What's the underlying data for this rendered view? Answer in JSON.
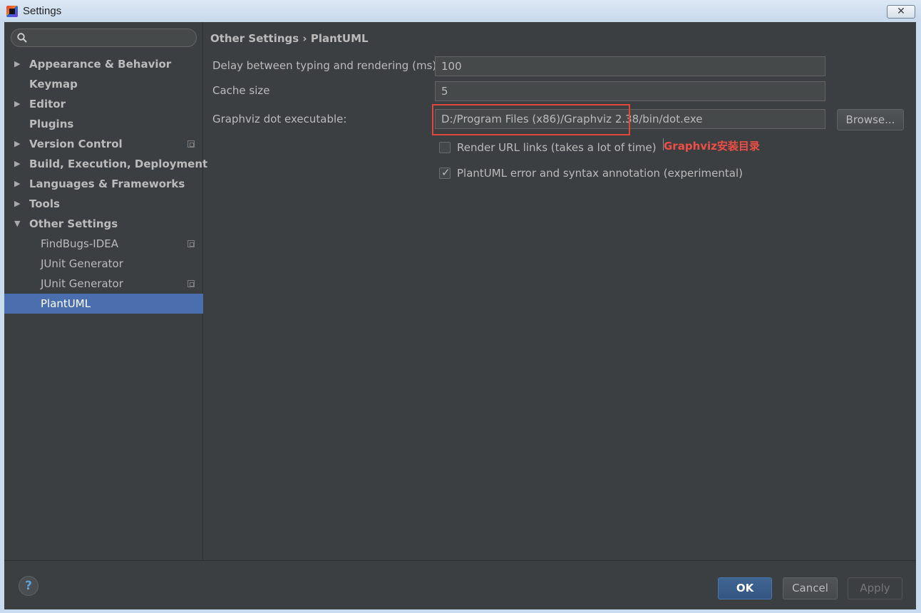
{
  "window": {
    "title": "Settings",
    "close_glyph": "✕"
  },
  "sidebar": {
    "search_placeholder": "",
    "items": [
      {
        "label": "Appearance & Behavior",
        "expandable": true,
        "expanded": false,
        "bold": true
      },
      {
        "label": "Keymap",
        "expandable": false,
        "bold": true
      },
      {
        "label": "Editor",
        "expandable": true,
        "expanded": false,
        "bold": true
      },
      {
        "label": "Plugins",
        "expandable": false,
        "bold": true
      },
      {
        "label": "Version Control",
        "expandable": true,
        "expanded": false,
        "bold": true,
        "project_icon": true
      },
      {
        "label": "Build, Execution, Deployment",
        "expandable": true,
        "expanded": false,
        "bold": true
      },
      {
        "label": "Languages & Frameworks",
        "expandable": true,
        "expanded": false,
        "bold": true
      },
      {
        "label": "Tools",
        "expandable": true,
        "expanded": false,
        "bold": true
      },
      {
        "label": "Other Settings",
        "expandable": true,
        "expanded": true,
        "bold": true
      },
      {
        "label": "FindBugs-IDEA",
        "child": true,
        "project_icon": true
      },
      {
        "label": "JUnit Generator",
        "child": true
      },
      {
        "label": "JUnit Generator",
        "child": true,
        "project_icon": true
      },
      {
        "label": "PlantUML",
        "child": true,
        "selected": true
      }
    ],
    "arrows": {
      "collapsed": "▶",
      "expanded": "▼"
    }
  },
  "content": {
    "breadcrumb": "Other Settings › PlantUML",
    "fields": {
      "delay_label": "Delay between typing and rendering (ms)",
      "delay_value": "100",
      "cache_label": "Cache size",
      "cache_value": "5",
      "graphviz_label": "Graphviz dot executable:",
      "graphviz_value": "D:/Program Files (x86)/Graphviz 2.38/bin/dot.exe",
      "browse_label": "Browse..."
    },
    "checkboxes": {
      "render_url": {
        "label": "Render URL links (takes a lot of time)",
        "checked": false
      },
      "error_annotation": {
        "label": "PlantUML error and syntax annotation (experimental)",
        "checked": true
      }
    },
    "annotation": "Graphviz安装目录",
    "check_glyph": "✓"
  },
  "footer": {
    "help": "?",
    "ok": "OK",
    "cancel": "Cancel",
    "apply": "Apply"
  },
  "colors": {
    "background": "#3c3f41",
    "selection": "#4b6eaf",
    "highlight": "#e0473b",
    "annotation": "#ee4e45",
    "primary_button": "#365880"
  }
}
